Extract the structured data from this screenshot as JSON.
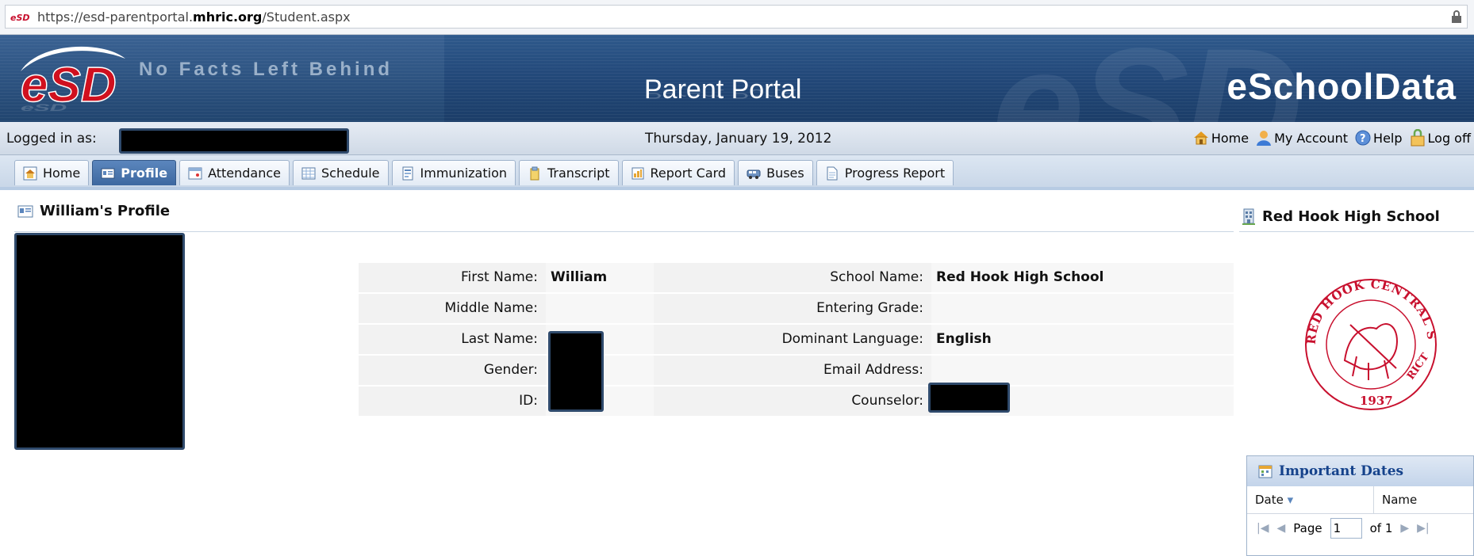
{
  "browser": {
    "url_prefix": "https://esd-parentportal.",
    "url_domain": "mhric.org",
    "url_suffix": "/Student.aspx",
    "favicon_text": "eSD"
  },
  "banner": {
    "logo_text": "eSD",
    "tagline": "No Facts Left Behind",
    "title": "Parent Portal",
    "brand": "eSchoolData",
    "background_watermark": "eSD"
  },
  "infobar": {
    "logged_in_label": "Logged in as:",
    "date": "Thursday, January 19, 2012",
    "links": [
      {
        "label": "Home",
        "icon": "home-icon"
      },
      {
        "label": "My Account",
        "icon": "account-icon"
      },
      {
        "label": "Help",
        "icon": "help-icon"
      },
      {
        "label": "Log off",
        "icon": "logoff-icon"
      }
    ]
  },
  "tabs": [
    {
      "label": "Home",
      "icon": "home-icon",
      "active": false
    },
    {
      "label": "Profile",
      "icon": "profile-card-icon",
      "active": true
    },
    {
      "label": "Attendance",
      "icon": "attendance-icon",
      "active": false
    },
    {
      "label": "Schedule",
      "icon": "schedule-icon",
      "active": false
    },
    {
      "label": "Immunization",
      "icon": "immunization-icon",
      "active": false
    },
    {
      "label": "Transcript",
      "icon": "transcript-icon",
      "active": false
    },
    {
      "label": "Report Card",
      "icon": "report-card-icon",
      "active": false
    },
    {
      "label": "Buses",
      "icon": "bus-icon",
      "active": false
    },
    {
      "label": "Progress Report",
      "icon": "progress-report-icon",
      "active": false
    }
  ],
  "profile": {
    "title": "William's Profile",
    "fields_left": [
      {
        "label": "First Name:",
        "value": "William"
      },
      {
        "label": "Middle Name:",
        "value": ""
      },
      {
        "label": "Last Name:",
        "value": ""
      },
      {
        "label": "Gender:",
        "value": ""
      },
      {
        "label": "ID:",
        "value": ""
      }
    ],
    "fields_right": [
      {
        "label": "School Name:",
        "value": "Red Hook High School"
      },
      {
        "label": "Entering Grade:",
        "value": ""
      },
      {
        "label": "Dominant Language:",
        "value": "English"
      },
      {
        "label": "Email Address:",
        "value": ""
      },
      {
        "label": "Counselor:",
        "value": ""
      }
    ]
  },
  "school": {
    "title": "Red Hook High School",
    "seal_text_top": "RED HOOK CENTRAL SCHOOL DIST",
    "seal_text_bottom": "RICT",
    "seal_year": "1937",
    "seal_color": "#c8102e"
  },
  "important_dates": {
    "title": "Important Dates",
    "col_date": "Date",
    "col_name": "Name",
    "page_label": "Page",
    "page_value": "1",
    "of_label": "of 1"
  },
  "colors": {
    "banner": "#23497a",
    "active_tab": "#4672aa",
    "redaction": "#000000"
  }
}
